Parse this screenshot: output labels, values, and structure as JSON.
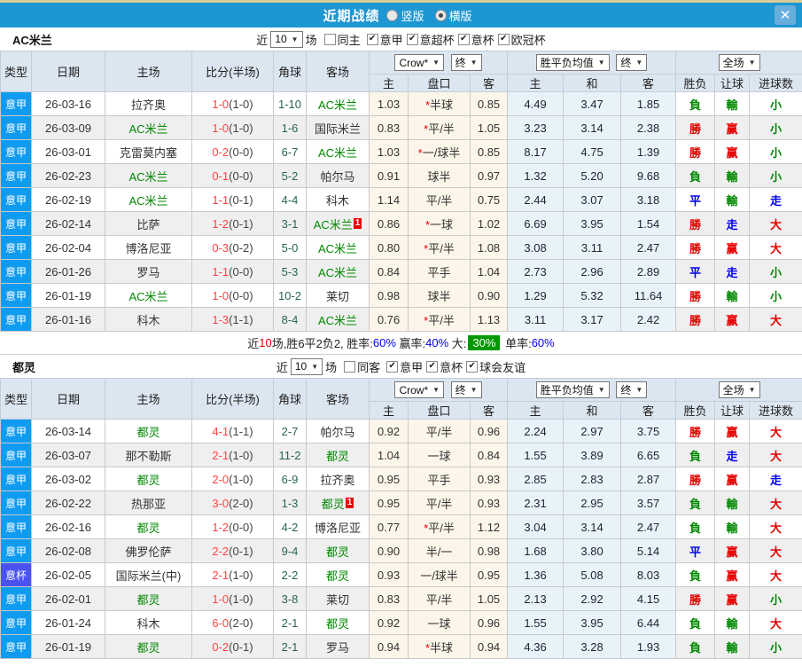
{
  "titlebar": {
    "title": "近期战绩",
    "option_vertical": "竖版",
    "option_horizontal": "横版",
    "selected_option": "横版",
    "close_label": "✕"
  },
  "table_header": {
    "type": "类型",
    "date": "日期",
    "home": "主场",
    "score": "比分(半场)",
    "corner": "角球",
    "away": "客场",
    "odds_group": {
      "bookmaker": "Crow*",
      "time": "终",
      "home": "主",
      "handicap": "盘口",
      "away": "客"
    },
    "avg_group": {
      "label": "胜平负均值",
      "time": "终",
      "home": "主",
      "draw": "和",
      "away": "客"
    },
    "result_group": {
      "scope": "全场",
      "result": "胜负",
      "handicap": "让球",
      "goals": "进球数"
    }
  },
  "colors": {
    "accent_bar": "#1e96d2",
    "league_badge": "#0f9cf0",
    "cup_badge": "#4a52ef",
    "team_highlight": "#008800",
    "win": "#e60000",
    "loss": "#008800",
    "draw": "#0000ee",
    "summary_badge_bg": "#009900"
  },
  "sections": [
    {
      "team": "AC米兰",
      "filter": {
        "near": "近",
        "count": "10",
        "unit": "场",
        "same_label": "同主",
        "same_checked": false,
        "comps": [
          {
            "label": "意甲",
            "checked": true
          },
          {
            "label": "意超杯",
            "checked": true
          },
          {
            "label": "意杯",
            "checked": true
          },
          {
            "label": "欧冠杯",
            "checked": true
          }
        ]
      },
      "rows": [
        {
          "type": "意甲",
          "type_style": "league",
          "date": "26-03-16",
          "home": "拉齐奥",
          "home_hl": false,
          "score": "1-0",
          "half": "(1-0)",
          "corner": "1-10",
          "away": "AC米兰",
          "away_hl": true,
          "away_badge": "",
          "odds_home": "1.03",
          "handicap": "*半球",
          "odds_away": "0.85",
          "avg_home": "4.49",
          "avg_draw": "3.47",
          "avg_away": "1.85",
          "result": "負",
          "handicap_result": "輸",
          "goals_result": "小"
        },
        {
          "type": "意甲",
          "type_style": "league",
          "date": "26-03-09",
          "home": "AC米兰",
          "home_hl": true,
          "score": "1-0",
          "half": "(1-0)",
          "corner": "1-6",
          "away": "国际米兰",
          "away_hl": false,
          "away_badge": "",
          "odds_home": "0.83",
          "handicap": "*平/半",
          "odds_away": "1.05",
          "avg_home": "3.23",
          "avg_draw": "3.14",
          "avg_away": "2.38",
          "result": "勝",
          "handicap_result": "赢",
          "goals_result": "小"
        },
        {
          "type": "意甲",
          "type_style": "league",
          "date": "26-03-01",
          "home": "克雷莫内塞",
          "home_hl": false,
          "score": "0-2",
          "half": "(0-0)",
          "corner": "6-7",
          "away": "AC米兰",
          "away_hl": true,
          "away_badge": "",
          "odds_home": "1.03",
          "handicap": "*一/球半",
          "odds_away": "0.85",
          "avg_home": "8.17",
          "avg_draw": "4.75",
          "avg_away": "1.39",
          "result": "勝",
          "handicap_result": "赢",
          "goals_result": "小"
        },
        {
          "type": "意甲",
          "type_style": "league",
          "date": "26-02-23",
          "home": "AC米兰",
          "home_hl": true,
          "score": "0-1",
          "half": "(0-0)",
          "corner": "5-2",
          "away": "帕尔马",
          "away_hl": false,
          "away_badge": "",
          "odds_home": "0.91",
          "handicap": "球半",
          "odds_away": "0.97",
          "avg_home": "1.32",
          "avg_draw": "5.20",
          "avg_away": "9.68",
          "result": "負",
          "handicap_result": "輸",
          "goals_result": "小"
        },
        {
          "type": "意甲",
          "type_style": "league",
          "date": "26-02-19",
          "home": "AC米兰",
          "home_hl": true,
          "score": "1-1",
          "half": "(0-1)",
          "corner": "4-4",
          "away": "科木",
          "away_hl": false,
          "away_badge": "",
          "odds_home": "1.14",
          "handicap": "平/半",
          "odds_away": "0.75",
          "avg_home": "2.44",
          "avg_draw": "3.07",
          "avg_away": "3.18",
          "result": "平",
          "handicap_result": "輸",
          "goals_result": "走"
        },
        {
          "type": "意甲",
          "type_style": "league",
          "date": "26-02-14",
          "home": "比萨",
          "home_hl": false,
          "score": "1-2",
          "half": "(0-1)",
          "corner": "3-1",
          "away": "AC米兰",
          "away_hl": true,
          "away_badge": "1",
          "odds_home": "0.86",
          "handicap": "*一球",
          "odds_away": "1.02",
          "avg_home": "6.69",
          "avg_draw": "3.95",
          "avg_away": "1.54",
          "result": "勝",
          "handicap_result": "走",
          "goals_result": "大"
        },
        {
          "type": "意甲",
          "type_style": "league",
          "date": "26-02-04",
          "home": "博洛尼亚",
          "home_hl": false,
          "score": "0-3",
          "half": "(0-2)",
          "corner": "5-0",
          "away": "AC米兰",
          "away_hl": true,
          "away_badge": "",
          "odds_home": "0.80",
          "handicap": "*平/半",
          "odds_away": "1.08",
          "avg_home": "3.08",
          "avg_draw": "3.11",
          "avg_away": "2.47",
          "result": "勝",
          "handicap_result": "赢",
          "goals_result": "大"
        },
        {
          "type": "意甲",
          "type_style": "league",
          "date": "26-01-26",
          "home": "罗马",
          "home_hl": false,
          "score": "1-1",
          "half": "(0-0)",
          "corner": "5-3",
          "away": "AC米兰",
          "away_hl": true,
          "away_badge": "",
          "odds_home": "0.84",
          "handicap": "平手",
          "odds_away": "1.04",
          "avg_home": "2.73",
          "avg_draw": "2.96",
          "avg_away": "2.89",
          "result": "平",
          "handicap_result": "走",
          "goals_result": "小"
        },
        {
          "type": "意甲",
          "type_style": "league",
          "date": "26-01-19",
          "home": "AC米兰",
          "home_hl": true,
          "score": "1-0",
          "half": "(0-0)",
          "corner": "10-2",
          "away": "莱切",
          "away_hl": false,
          "away_badge": "",
          "odds_home": "0.98",
          "handicap": "球半",
          "odds_away": "0.90",
          "avg_home": "1.29",
          "avg_draw": "5.32",
          "avg_away": "11.64",
          "result": "勝",
          "handicap_result": "輸",
          "goals_result": "小"
        },
        {
          "type": "意甲",
          "type_style": "league",
          "date": "26-01-16",
          "home": "科木",
          "home_hl": false,
          "score": "1-3",
          "half": "(1-1)",
          "corner": "8-4",
          "away": "AC米兰",
          "away_hl": true,
          "away_badge": "",
          "odds_home": "0.76",
          "handicap": "*平/半",
          "odds_away": "1.13",
          "avg_home": "3.11",
          "avg_draw": "3.17",
          "avg_away": "2.42",
          "result": "勝",
          "handicap_result": "赢",
          "goals_result": "大"
        }
      ],
      "summary": {
        "parts": [
          {
            "text": "近",
            "style": "plain"
          },
          {
            "text": "10",
            "style": "red"
          },
          {
            "text": "场,胜6平2负2, 胜率:",
            "style": "plain"
          },
          {
            "text": "60%",
            "style": "blue"
          },
          {
            "text": " 赢率:",
            "style": "plain"
          },
          {
            "text": "40%",
            "style": "blue"
          },
          {
            "text": " 大:",
            "style": "plain"
          },
          {
            "text": "30%",
            "style": "badge"
          },
          {
            "text": " 单率:",
            "style": "plain"
          },
          {
            "text": "60%",
            "style": "blue"
          }
        ]
      }
    },
    {
      "team": "都灵",
      "filter": {
        "near": "近",
        "count": "10",
        "unit": "场",
        "same_label": "同客",
        "same_checked": false,
        "comps": [
          {
            "label": "意甲",
            "checked": true
          },
          {
            "label": "意杯",
            "checked": true
          },
          {
            "label": "球会友谊",
            "checked": true
          }
        ]
      },
      "rows": [
        {
          "type": "意甲",
          "type_style": "league",
          "date": "26-03-14",
          "home": "都灵",
          "home_hl": true,
          "score": "4-1",
          "half": "(1-1)",
          "corner": "2-7",
          "away": "帕尔马",
          "away_hl": false,
          "away_badge": "",
          "odds_home": "0.92",
          "handicap": "平/半",
          "odds_away": "0.96",
          "avg_home": "2.24",
          "avg_draw": "2.97",
          "avg_away": "3.75",
          "result": "勝",
          "handicap_result": "赢",
          "goals_result": "大"
        },
        {
          "type": "意甲",
          "type_style": "league",
          "date": "26-03-07",
          "home": "那不勒斯",
          "home_hl": false,
          "score": "2-1",
          "half": "(1-0)",
          "corner": "11-2",
          "away": "都灵",
          "away_hl": true,
          "away_badge": "",
          "odds_home": "1.04",
          "handicap": "一球",
          "odds_away": "0.84",
          "avg_home": "1.55",
          "avg_draw": "3.89",
          "avg_away": "6.65",
          "result": "負",
          "handicap_result": "走",
          "goals_result": "大"
        },
        {
          "type": "意甲",
          "type_style": "league",
          "date": "26-03-02",
          "home": "都灵",
          "home_hl": true,
          "score": "2-0",
          "half": "(1-0)",
          "corner": "6-9",
          "away": "拉齐奥",
          "away_hl": false,
          "away_badge": "",
          "odds_home": "0.95",
          "handicap": "平手",
          "odds_away": "0.93",
          "avg_home": "2.85",
          "avg_draw": "2.83",
          "avg_away": "2.87",
          "result": "勝",
          "handicap_result": "赢",
          "goals_result": "走"
        },
        {
          "type": "意甲",
          "type_style": "league",
          "date": "26-02-22",
          "home": "热那亚",
          "home_hl": false,
          "score": "3-0",
          "half": "(2-0)",
          "corner": "1-3",
          "away": "都灵",
          "away_hl": true,
          "away_badge": "1",
          "odds_home": "0.95",
          "handicap": "平/半",
          "odds_away": "0.93",
          "avg_home": "2.31",
          "avg_draw": "2.95",
          "avg_away": "3.57",
          "result": "負",
          "handicap_result": "輸",
          "goals_result": "大"
        },
        {
          "type": "意甲",
          "type_style": "league",
          "date": "26-02-16",
          "home": "都灵",
          "home_hl": true,
          "score": "1-2",
          "half": "(0-0)",
          "corner": "4-2",
          "away": "博洛尼亚",
          "away_hl": false,
          "away_badge": "",
          "odds_home": "0.77",
          "handicap": "*平/半",
          "odds_away": "1.12",
          "avg_home": "3.04",
          "avg_draw": "3.14",
          "avg_away": "2.47",
          "result": "負",
          "handicap_result": "輸",
          "goals_result": "大"
        },
        {
          "type": "意甲",
          "type_style": "league",
          "date": "26-02-08",
          "home": "佛罗伦萨",
          "home_hl": false,
          "score": "2-2",
          "half": "(0-1)",
          "corner": "9-4",
          "away": "都灵",
          "away_hl": true,
          "away_badge": "",
          "odds_home": "0.90",
          "handicap": "半/一",
          "odds_away": "0.98",
          "avg_home": "1.68",
          "avg_draw": "3.80",
          "avg_away": "5.14",
          "result": "平",
          "handicap_result": "赢",
          "goals_result": "大"
        },
        {
          "type": "意杯",
          "type_style": "cup",
          "date": "26-02-05",
          "home": "国际米兰(中)",
          "home_hl": false,
          "score": "2-1",
          "half": "(1-0)",
          "corner": "2-2",
          "away": "都灵",
          "away_hl": true,
          "away_badge": "",
          "odds_home": "0.93",
          "handicap": "一/球半",
          "odds_away": "0.95",
          "avg_home": "1.36",
          "avg_draw": "5.08",
          "avg_away": "8.03",
          "result": "負",
          "handicap_result": "赢",
          "goals_result": "大"
        },
        {
          "type": "意甲",
          "type_style": "league",
          "date": "26-02-01",
          "home": "都灵",
          "home_hl": true,
          "score": "1-0",
          "half": "(1-0)",
          "corner": "3-8",
          "away": "莱切",
          "away_hl": false,
          "away_badge": "",
          "odds_home": "0.83",
          "handicap": "平/半",
          "odds_away": "1.05",
          "avg_home": "2.13",
          "avg_draw": "2.92",
          "avg_away": "4.15",
          "result": "勝",
          "handicap_result": "赢",
          "goals_result": "小"
        },
        {
          "type": "意甲",
          "type_style": "league",
          "date": "26-01-24",
          "home": "科木",
          "home_hl": false,
          "score": "6-0",
          "half": "(2-0)",
          "corner": "2-1",
          "away": "都灵",
          "away_hl": true,
          "away_badge": "",
          "odds_home": "0.92",
          "handicap": "一球",
          "odds_away": "0.96",
          "avg_home": "1.55",
          "avg_draw": "3.95",
          "avg_away": "6.44",
          "result": "負",
          "handicap_result": "輸",
          "goals_result": "大"
        },
        {
          "type": "意甲",
          "type_style": "league",
          "date": "26-01-19",
          "home": "都灵",
          "home_hl": true,
          "score": "0-2",
          "half": "(0-1)",
          "corner": "2-1",
          "away": "罗马",
          "away_hl": false,
          "away_badge": "",
          "odds_home": "0.94",
          "handicap": "*半球",
          "odds_away": "0.94",
          "avg_home": "4.36",
          "avg_draw": "3.28",
          "avg_away": "1.93",
          "result": "負",
          "handicap_result": "輸",
          "goals_result": "小"
        }
      ],
      "summary": null
    }
  ]
}
